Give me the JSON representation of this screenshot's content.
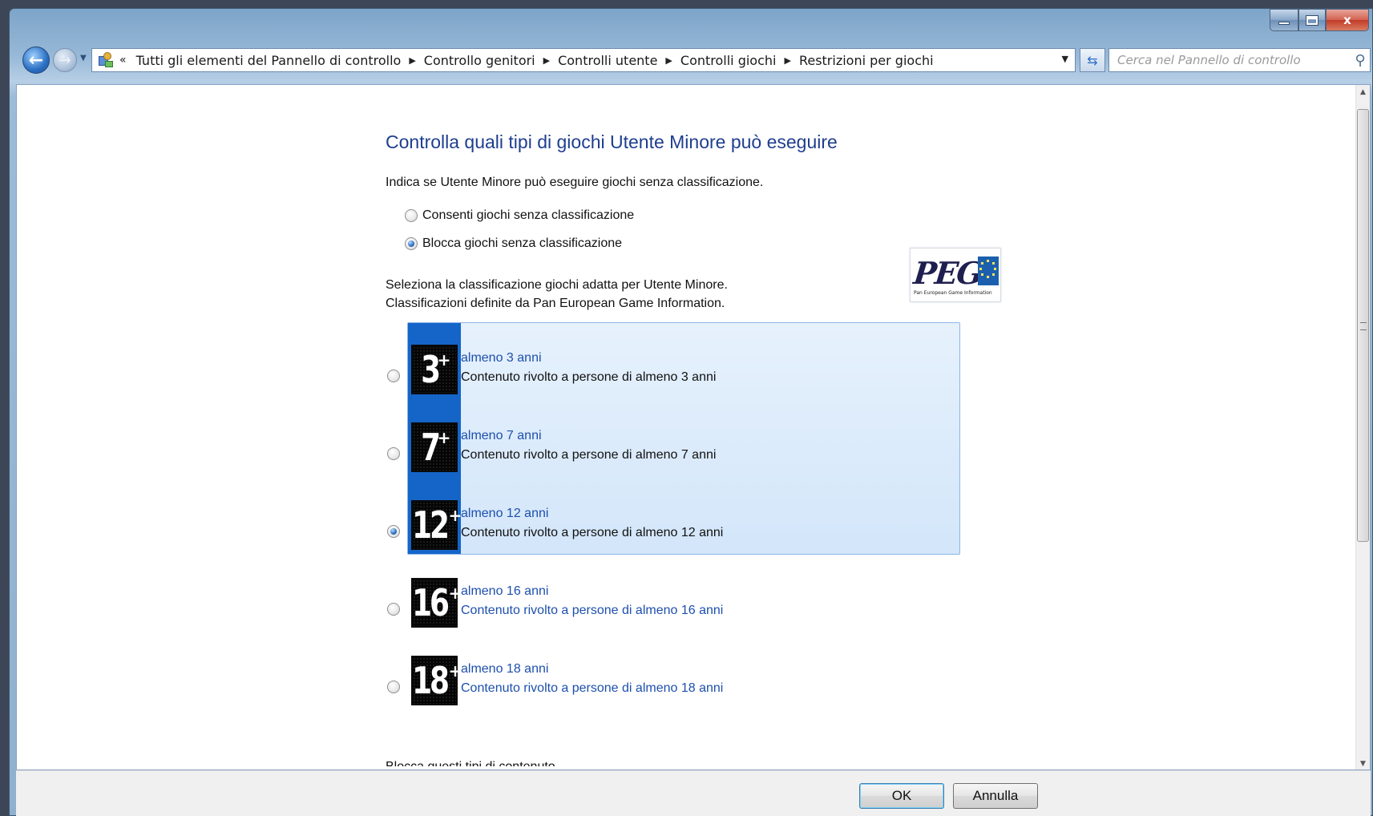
{
  "window": {
    "controls": {
      "minimize": "",
      "maximize": "",
      "close": "x"
    }
  },
  "nav": {
    "breadcrumb_overflow": "«",
    "breadcrumbs": [
      "Tutti gli elementi del Pannello di controllo",
      "Controllo genitori",
      "Controlli utente",
      "Controlli giochi",
      "Restrizioni per giochi"
    ],
    "search_placeholder": "Cerca nel Pannello di controllo"
  },
  "content": {
    "heading": "Controlla quali tipi di giochi Utente Minore può eseguire",
    "unrated_prompt": "Indica se Utente Minore può eseguire giochi senza classificazione.",
    "unrated_options": [
      {
        "label": "Consenti giochi senza classificazione",
        "checked": false
      },
      {
        "label": "Blocca giochi senza classificazione",
        "checked": true
      }
    ],
    "rating_prompt_line1": "Seleziona la classificazione giochi adatta per Utente Minore.",
    "rating_prompt_line2": "Classificazioni definite da Pan European Game Information.",
    "pegi_logo": {
      "word": "PEGI",
      "subtitle": "Pan European Game Information"
    },
    "ratings": [
      {
        "number": "3",
        "title": "almeno 3 anni",
        "description": "Contenuto rivolto a persone di almeno 3 anni",
        "checked": false,
        "allowed": true
      },
      {
        "number": "7",
        "title": "almeno 7 anni",
        "description": "Contenuto rivolto a persone di almeno 7 anni",
        "checked": false,
        "allowed": true
      },
      {
        "number": "12",
        "title": "almeno 12 anni",
        "description": "Contenuto rivolto a persone di almeno 12 anni",
        "checked": true,
        "allowed": true
      },
      {
        "number": "16",
        "title": "almeno 16 anni",
        "description": "Contenuto rivolto a persone di almeno 16 anni",
        "checked": false,
        "allowed": false
      },
      {
        "number": "18",
        "title": "almeno 18 anni",
        "description": "Contenuto rivolto a persone di almeno 18 anni",
        "checked": false,
        "allowed": false
      }
    ],
    "cut_off_text": "Blocca questi tipi di contenuto"
  },
  "footer": {
    "ok_label": "OK",
    "cancel_label": "Annulla"
  },
  "colors": {
    "heading": "#1e3e8f",
    "link": "#1d4fae",
    "selection_bar": "#1565c8",
    "selection_fill": "#d3e6fa"
  },
  "icons": {
    "back": "arrow-left-icon",
    "forward": "arrow-right-icon",
    "refresh": "refresh-icon",
    "search": "search-icon",
    "control_panel": "control-panel-icon"
  }
}
